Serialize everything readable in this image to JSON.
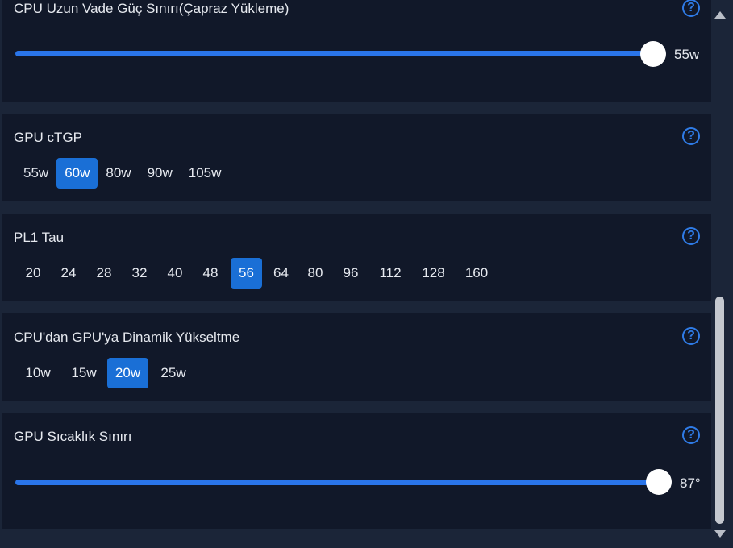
{
  "cards": {
    "cpu_long_power": {
      "title": "CPU Uzun Vade Güç Sınırı(Çapraz Yükleme)",
      "value_label": "55w",
      "fraction": 1.0
    },
    "gpu_ctgp": {
      "title": "GPU cTGP",
      "options": [
        "55w",
        "60w",
        "80w",
        "90w",
        "105w"
      ],
      "selected": "60w"
    },
    "pl1_tau": {
      "title": "PL1 Tau",
      "options": [
        "20",
        "24",
        "28",
        "32",
        "40",
        "48",
        "56",
        "64",
        "80",
        "96",
        "112",
        "128",
        "160"
      ],
      "selected": "56"
    },
    "dynamic_boost": {
      "title": "CPU'dan GPU'ya Dinamik Yükseltme",
      "options": [
        "10w",
        "15w",
        "20w",
        "25w"
      ],
      "selected": "20w"
    },
    "gpu_temp_limit": {
      "title": "GPU Sıcaklık Sınırı",
      "value_label": "87°",
      "fraction": 1.0
    }
  },
  "help_glyph": "?",
  "icons": {
    "help": "question-circle-icon",
    "scroll_up": "triangle-up-icon",
    "scroll_down": "triangle-down-icon"
  },
  "colors": {
    "background": "#1b2538",
    "card": "#111829",
    "accent": "#2a75ea",
    "selected": "#1a6fd6",
    "help": "#2f7be6"
  }
}
